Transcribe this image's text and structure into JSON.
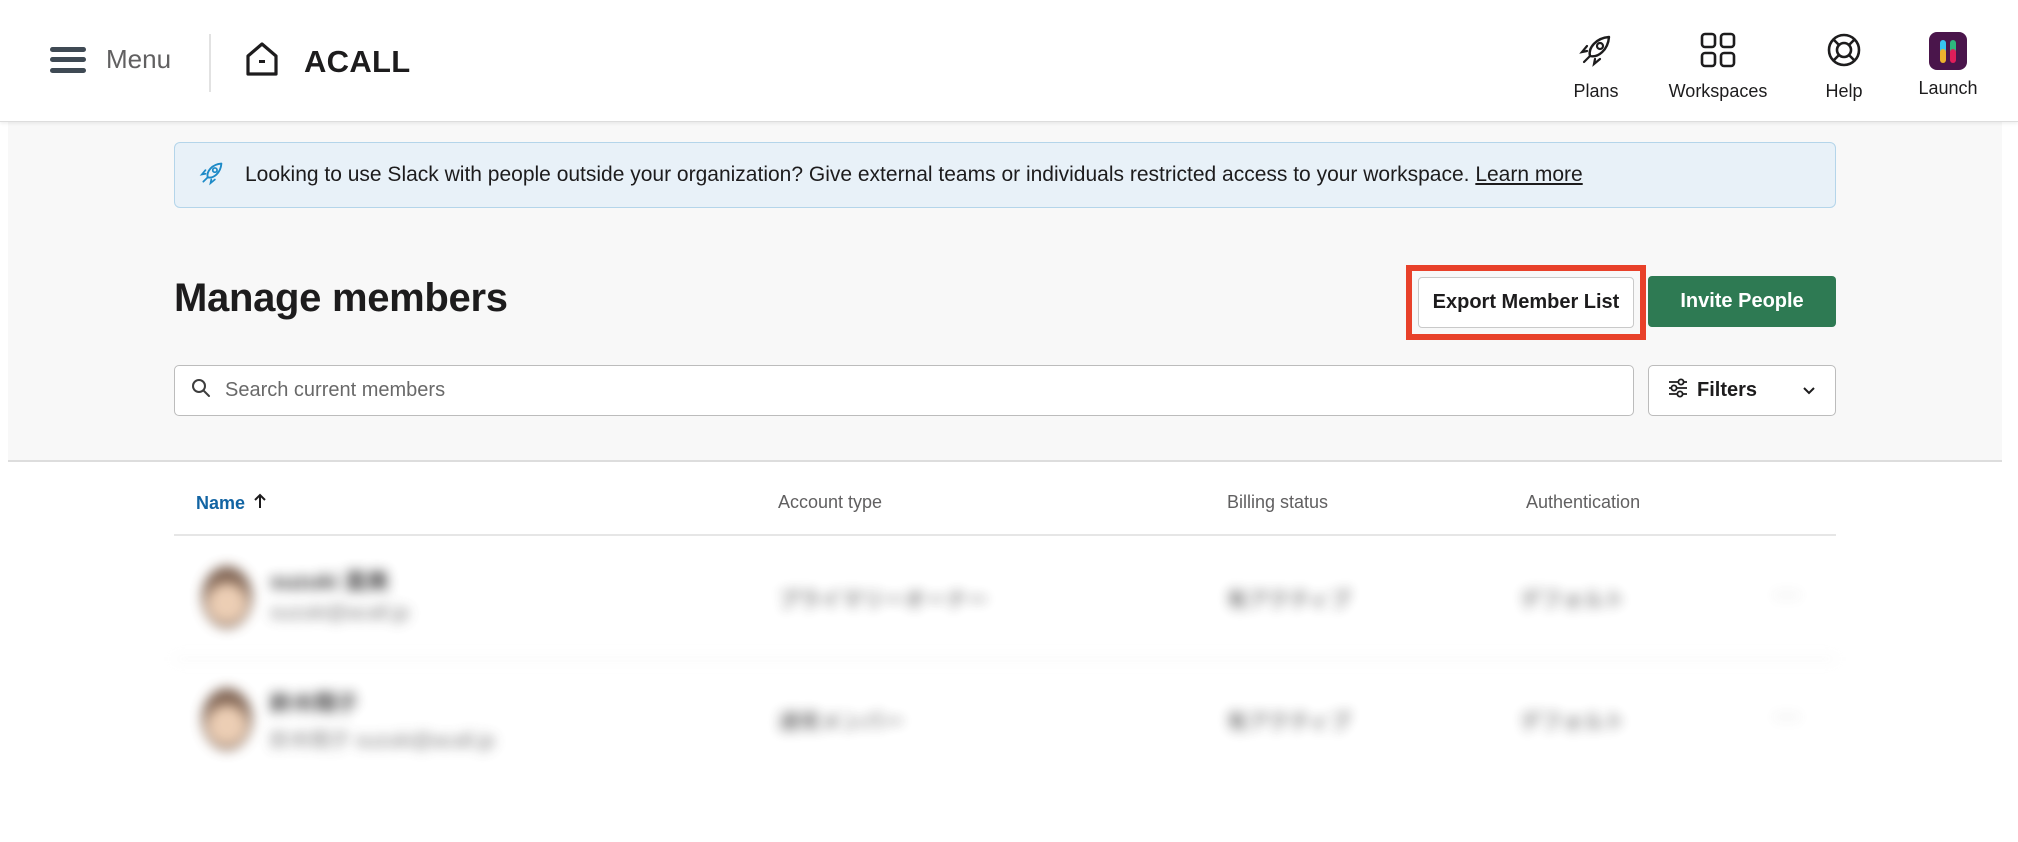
{
  "topbar": {
    "menu_label": "Menu",
    "brand_name": "ACALL",
    "nav": [
      {
        "label": "Plans",
        "icon": "rocket-icon"
      },
      {
        "label": "Workspaces",
        "icon": "grid-icon"
      },
      {
        "label": "Help",
        "icon": "lifebuoy-icon"
      },
      {
        "label": "Launch",
        "icon": "slack-logo-icon"
      }
    ]
  },
  "banner": {
    "text": "Looking to use Slack with people outside your organization? Give external teams or individuals restricted access to your workspace.",
    "link": "Learn more"
  },
  "page": {
    "title": "Manage members",
    "export_label": "Export Member List",
    "invite_label": "Invite People",
    "search_placeholder": "Search current members",
    "filters_label": "Filters"
  },
  "table": {
    "columns": [
      "Name",
      "Account type",
      "Billing status",
      "Authentication"
    ],
    "rows": [
      {
        "name": "suzuki 直美",
        "email": "suzuki@acall.jp",
        "account_type": "プライマリーオーナー",
        "billing": "有アクティブ",
        "auth": "デフォルト"
      },
      {
        "name": "鈴木翔子",
        "email": "鈴木翔子 suzuki@acall.jp",
        "account_type": "通常メンバー",
        "billing": "有アクティブ",
        "auth": "デフォルト"
      }
    ]
  },
  "colors": {
    "accent_green": "#2e7a53",
    "highlight_red": "#e8412a",
    "banner_bg": "#e8f1f8",
    "link_blue": "#1264a3"
  }
}
